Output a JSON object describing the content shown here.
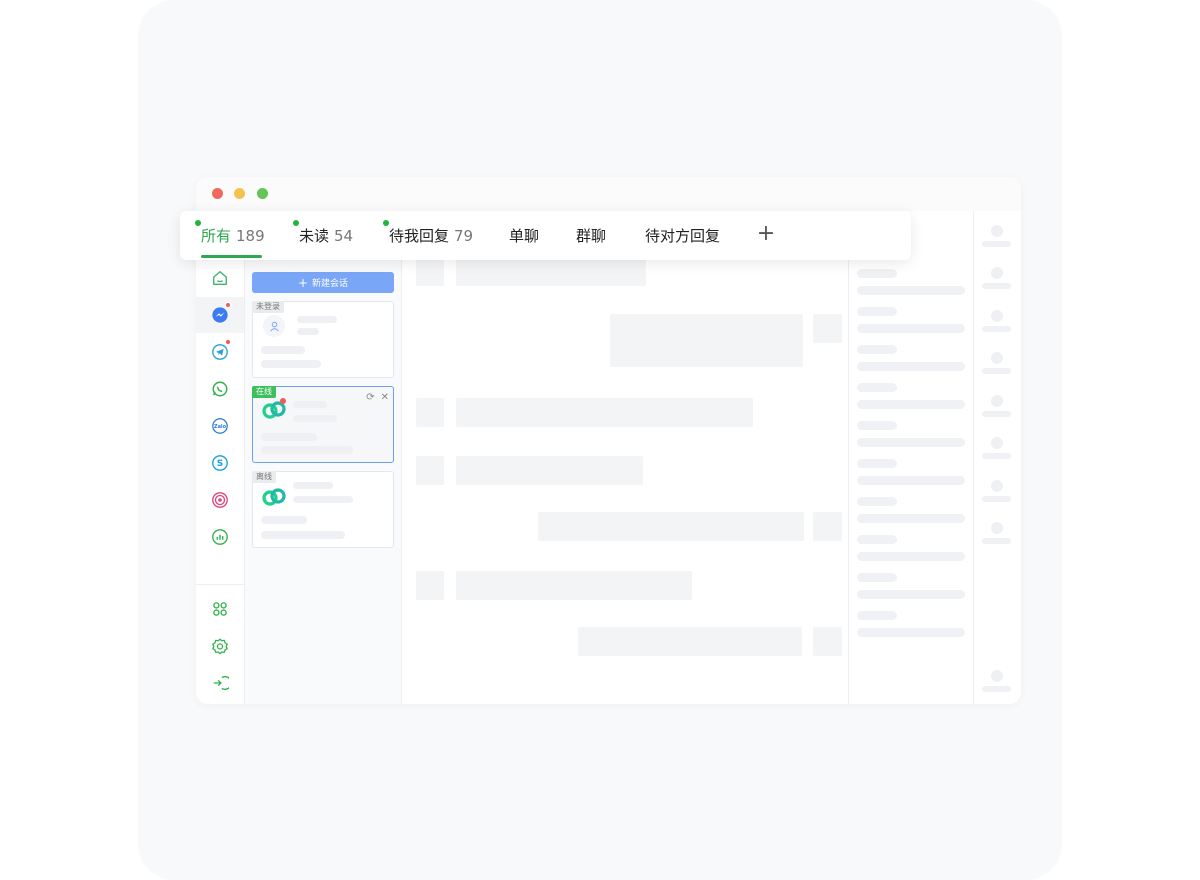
{
  "tabs": [
    {
      "label": "所有",
      "count": "189"
    },
    {
      "label": "未读",
      "count": "54"
    },
    {
      "label": "待我回复",
      "count": "79"
    },
    {
      "label": "单聊"
    },
    {
      "label": "群聊"
    },
    {
      "label": "待对方回复"
    }
  ],
  "tab_add_symbol": "+",
  "sessions": {
    "new_button_label": "新建会话",
    "cards": [
      {
        "tag": "未登录"
      },
      {
        "tag": "在线"
      },
      {
        "tag": "离线"
      }
    ]
  },
  "sidebar_icons": [
    "home-icon",
    "messenger-icon",
    "telegram-icon",
    "whatsapp-icon",
    "zalo-icon",
    "skype-icon",
    "instagram-icon",
    "analytics-icon",
    "apps-icon",
    "settings-icon",
    "logout-icon"
  ],
  "colors": {
    "accent": "#2da850",
    "primary_button": "#7aa6f7",
    "badge_red": "#f25a5a"
  }
}
